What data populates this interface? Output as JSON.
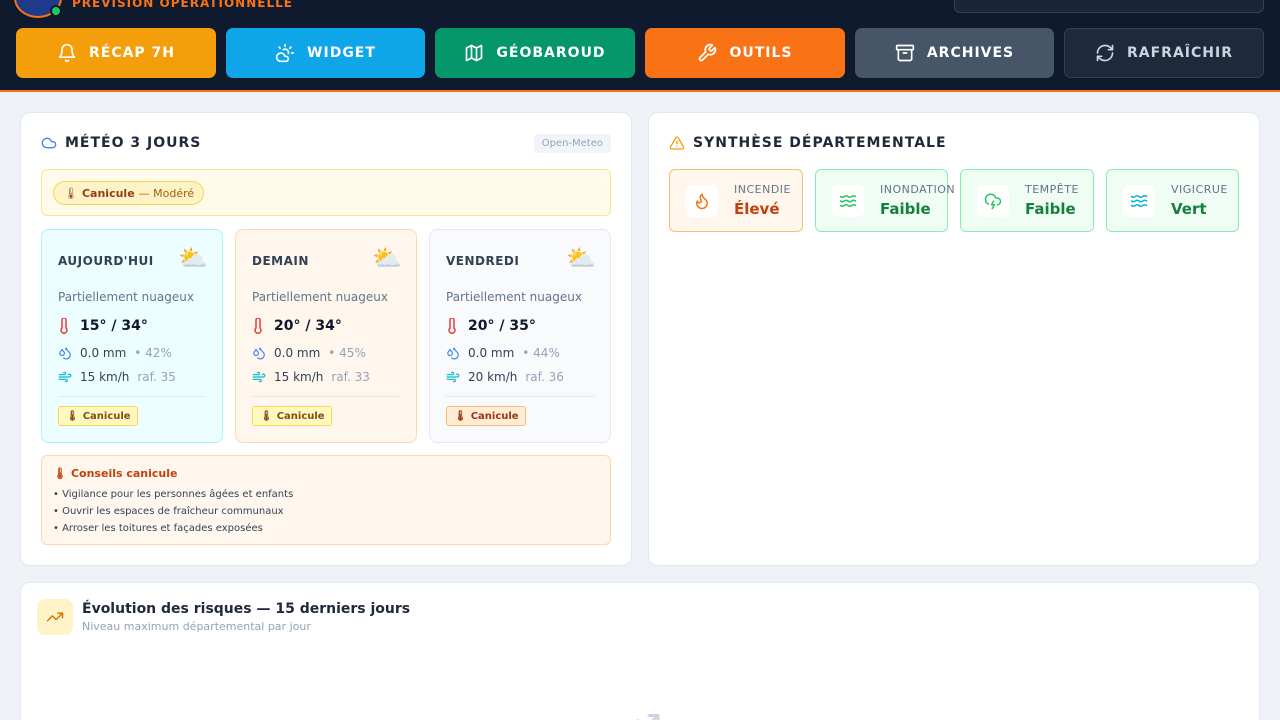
{
  "header": {
    "subtitle": "PRÉVISION OPÉRATIONNELLE",
    "nav": [
      {
        "label": "RÉCAP 7H",
        "icon": "bell-icon",
        "color": "#f59e0b"
      },
      {
        "label": "WIDGET",
        "icon": "sun-cloud-icon",
        "color": "#0ea5e9"
      },
      {
        "label": "GÉOBAROUD",
        "icon": "map-icon",
        "color": "#059669"
      },
      {
        "label": "OUTILS",
        "icon": "wrench-icon",
        "color": "#f97316"
      },
      {
        "label": "ARCHIVES",
        "icon": "archive-icon",
        "color": "#475569"
      },
      {
        "label": "RAFRAÎCHIR",
        "icon": "refresh-icon",
        "color": "#1e293b"
      }
    ]
  },
  "meteo": {
    "title": "MÉTÉO 3 JOURS",
    "source": "Open-Meteo",
    "alert": {
      "name": "Canicule",
      "level": "— Modéré"
    },
    "days": [
      {
        "name": "AUJOURD'HUI",
        "icon": "partly-cloudy-icon",
        "desc": "Partiellement nuageux",
        "temp": "15° / 34°",
        "rain": "0.0 mm",
        "humidity": "• 42%",
        "wind": "15 km/h",
        "gust": "raf. 35",
        "badge": "Canicule",
        "badge_color": "#fef9c3"
      },
      {
        "name": "DEMAIN",
        "icon": "partly-cloudy-icon",
        "desc": "Partiellement nuageux",
        "temp": "20° / 34°",
        "rain": "0.0 mm",
        "humidity": "• 45%",
        "wind": "15 km/h",
        "gust": "raf. 33",
        "badge": "Canicule",
        "badge_color": "#fef9c3"
      },
      {
        "name": "VENDREDI",
        "icon": "partly-cloudy-icon",
        "desc": "Partiellement nuageux",
        "temp": "20° / 35°",
        "rain": "0.0 mm",
        "humidity": "• 44%",
        "wind": "20 km/h",
        "gust": "raf. 36",
        "badge": "Canicule",
        "badge_color": "#ffedd5"
      }
    ],
    "advice": {
      "title": "Conseils canicule",
      "items": [
        "• Vigilance pour les personnes âgées et enfants",
        "• Ouvrir les espaces de fraîcheur communaux",
        "• Arroser les toitures et façades exposées"
      ]
    }
  },
  "synthese": {
    "title": "SYNTHÈSE DÉPARTEMENTALE",
    "risks": [
      {
        "label": "INCENDIE",
        "value": "Élevé",
        "icon": "flame-icon",
        "color": "#c2410c"
      },
      {
        "label": "INONDATION",
        "value": "Faible",
        "icon": "waves-icon",
        "color": "#15803d"
      },
      {
        "label": "TEMPÊTE",
        "value": "Faible",
        "icon": "storm-cloud-icon",
        "color": "#15803d"
      },
      {
        "label": "VIGICRUE",
        "value": "Vert",
        "icon": "water-icon",
        "color": "#15803d"
      }
    ]
  },
  "evolution": {
    "title": "Évolution des risques — 15 derniers jours",
    "subtitle": "Niveau maximum départemental par jour"
  }
}
